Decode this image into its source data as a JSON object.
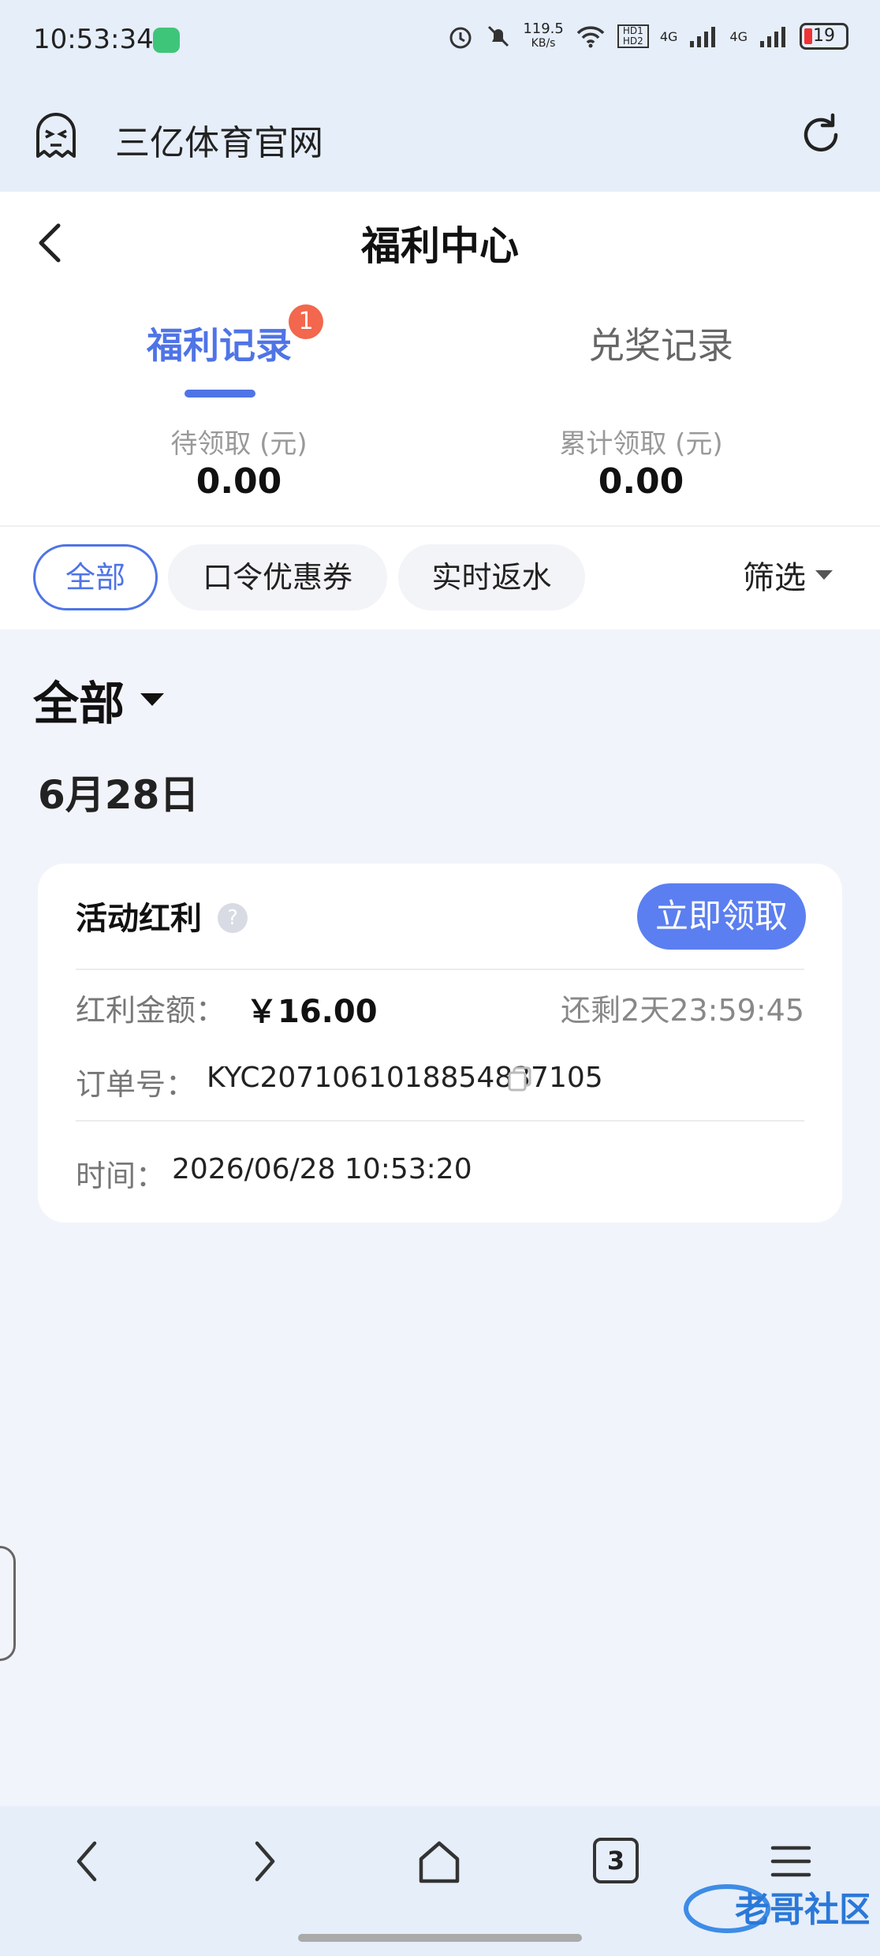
{
  "status_bar": {
    "time": "10:53:34",
    "speed": "119.5",
    "speed_unit": "KB/s",
    "hd": "HD1 HD2",
    "net1": "4G",
    "net2": "4G",
    "battery": "19"
  },
  "browser": {
    "site_title": "三亿体育官网",
    "open_tabs": "3"
  },
  "page": {
    "title": "福利中心",
    "tabs": [
      {
        "label": "福利记录",
        "badge": "1",
        "active": true
      },
      {
        "label": "兑奖记录",
        "active": false
      }
    ],
    "stats": [
      {
        "label": "待领取 (元)",
        "value": "0.00"
      },
      {
        "label": "累计领取 (元)",
        "value": "0.00"
      }
    ],
    "chips": [
      {
        "label": "全部",
        "active": true
      },
      {
        "label": "口令优惠券"
      },
      {
        "label": "实时返水"
      }
    ],
    "filter_label": "筛选",
    "section_title": "全部",
    "date_label": "6月28日"
  },
  "card": {
    "title": "活动红利",
    "help": "?",
    "claim_button": "立即领取",
    "amount_label": "红利金额：",
    "amount": "￥16.00",
    "remaining": "还剩2天23:59:45",
    "order_label": "订单号：",
    "order_no": "KYC2071061018854837105",
    "time_label": "时间：",
    "time": "2026/06/28 10:53:20"
  },
  "colors": {
    "accent": "#4f74e6",
    "button": "#5b7ff0",
    "badge": "#f2674d",
    "background": "#f2f4fb"
  }
}
